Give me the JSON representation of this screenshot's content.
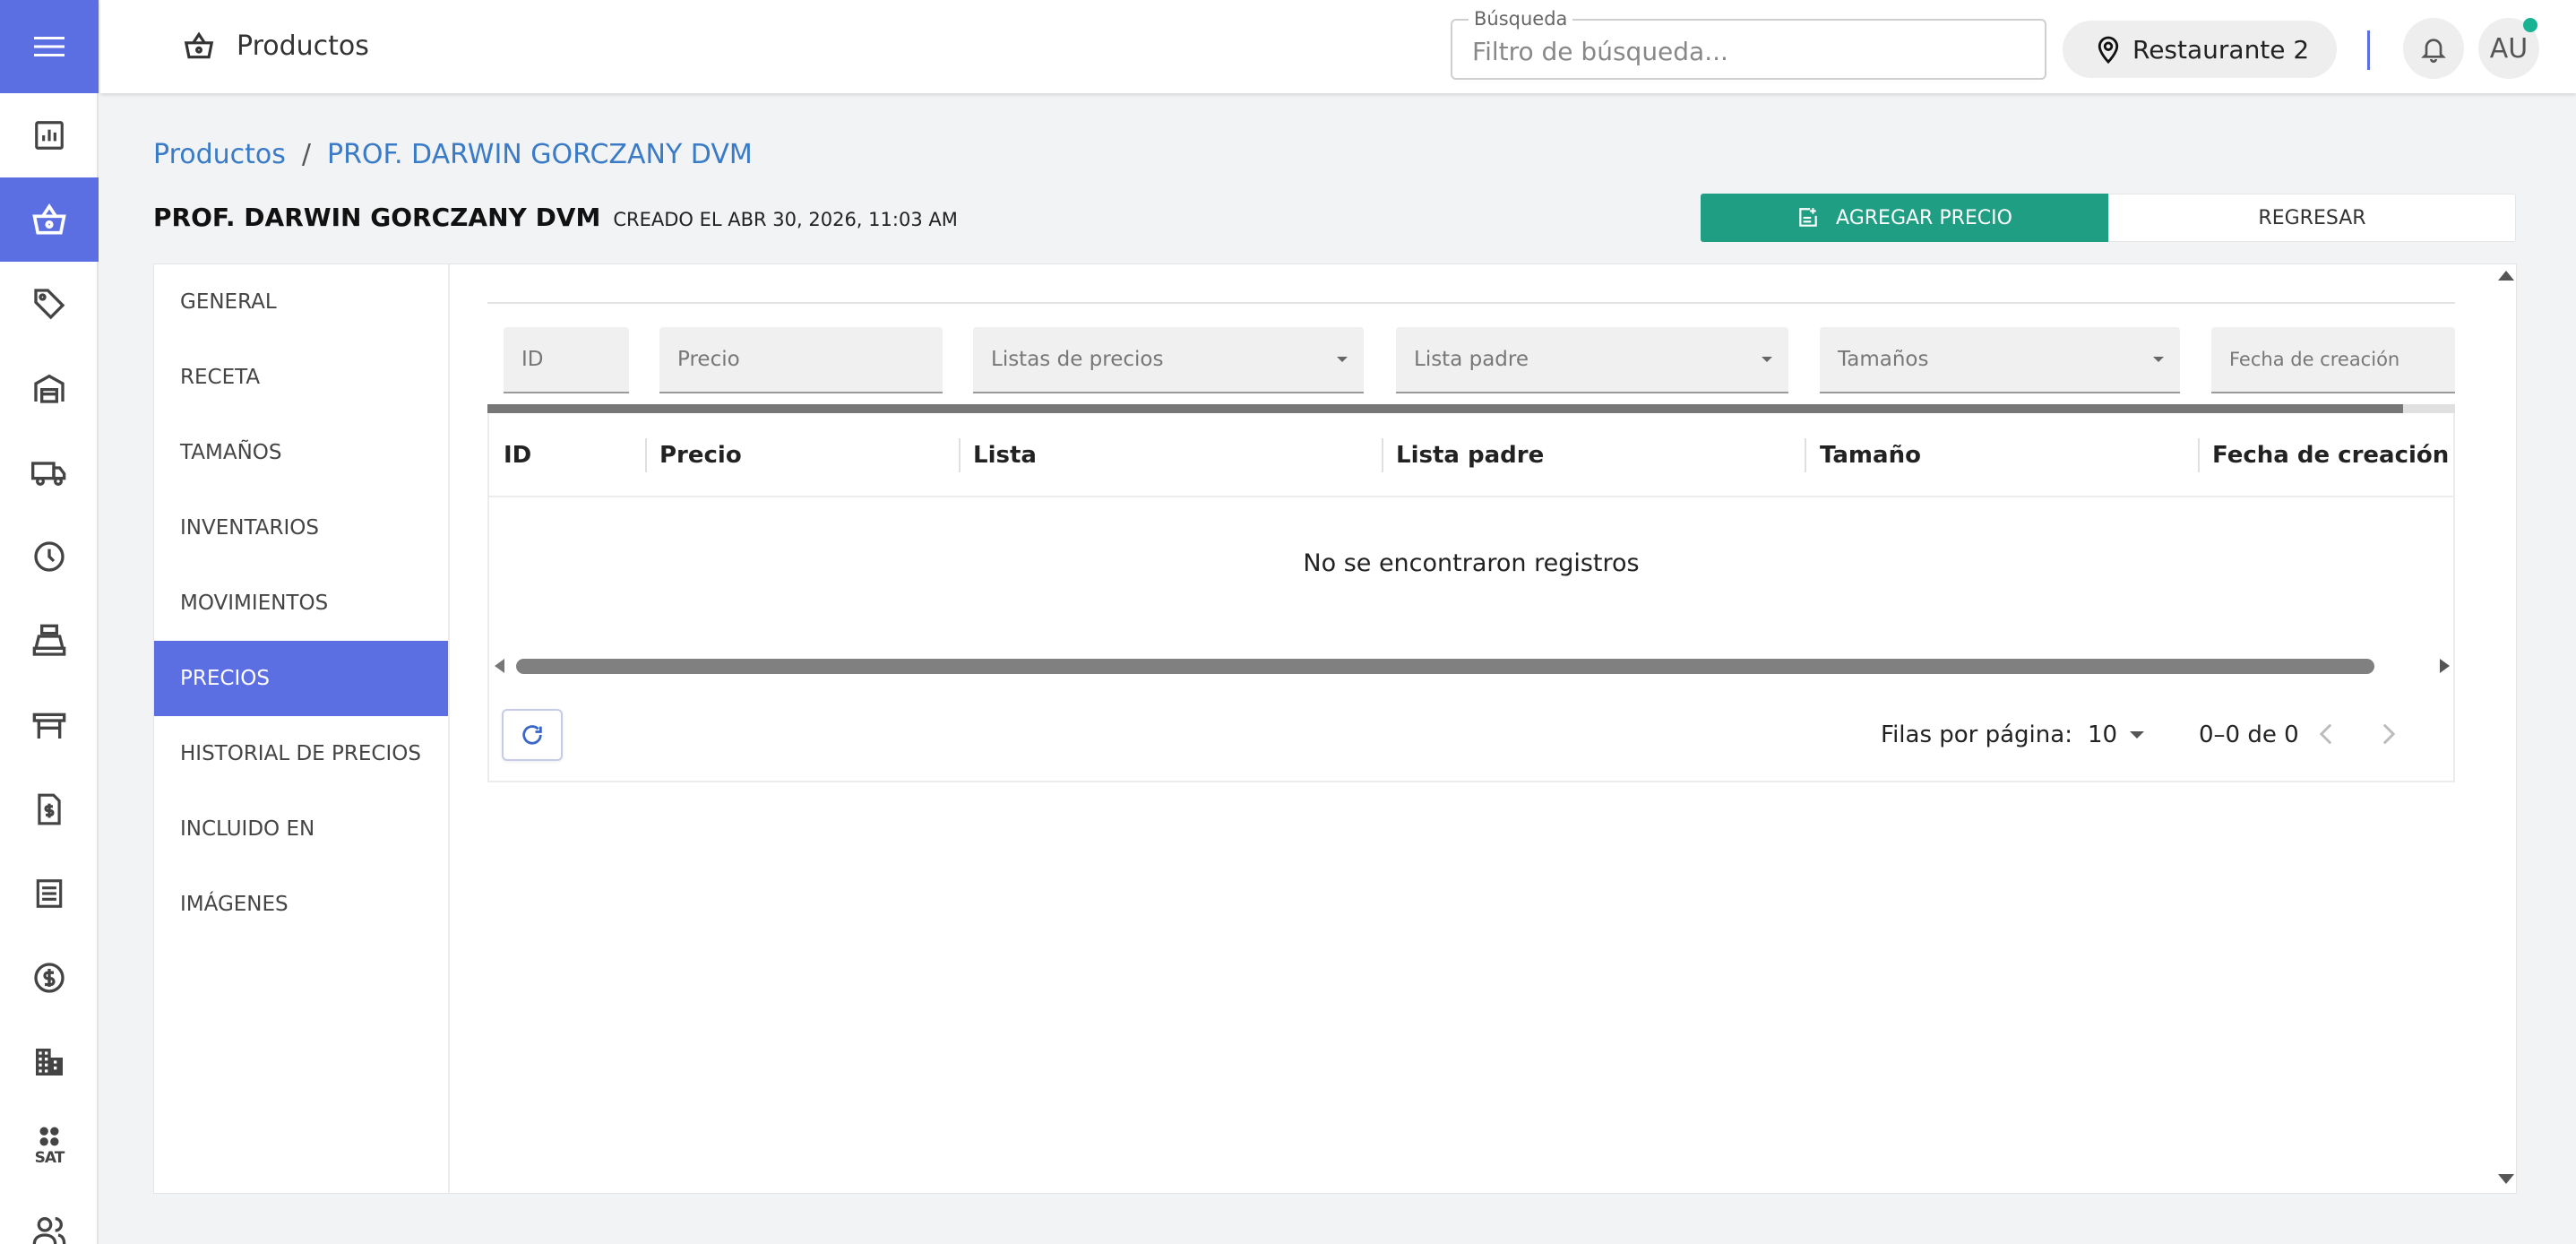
{
  "header": {
    "title": "Productos",
    "search_legend": "Búsqueda",
    "search_placeholder": "Filtro de búsqueda...",
    "location": "Restaurante 2",
    "avatar_initials": "AU"
  },
  "breadcrumb": {
    "root": "Productos",
    "separator": "/",
    "current": "PROF. DARWIN GORCZANY DVM"
  },
  "product": {
    "name": "PROF. DARWIN GORCZANY DVM",
    "created": "CREADO EL ABR 30, 2026, 11:03 AM"
  },
  "actions": {
    "add_price": "AGREGAR PRECIO",
    "back": "REGRESAR"
  },
  "side_menu": {
    "items": [
      {
        "label": "GENERAL"
      },
      {
        "label": "RECETA"
      },
      {
        "label": "TAMAÑOS"
      },
      {
        "label": "INVENTARIOS"
      },
      {
        "label": "MOVIMIENTOS"
      },
      {
        "label": "PRECIOS"
      },
      {
        "label": "HISTORIAL DE PRECIOS"
      },
      {
        "label": "INCLUIDO EN"
      },
      {
        "label": "IMÁGENES"
      }
    ],
    "active": "PRECIOS"
  },
  "filters": {
    "id": "ID",
    "price": "Precio",
    "price_lists": "Listas de precios",
    "parent_list": "Lista padre",
    "sizes": "Tamaños",
    "created_date": "Fecha de creación"
  },
  "table": {
    "columns": [
      "ID",
      "Precio",
      "Lista",
      "Lista padre",
      "Tamaño",
      "Fecha de creación"
    ],
    "empty_message": "No se encontraron registros"
  },
  "pagination": {
    "rows_label": "Filas por página:",
    "rows_value": "10",
    "range": "0–0 de 0"
  },
  "colors": {
    "accent": "#5b6fe3",
    "primary_action": "#1f9e84",
    "link": "#3a7bc8"
  }
}
